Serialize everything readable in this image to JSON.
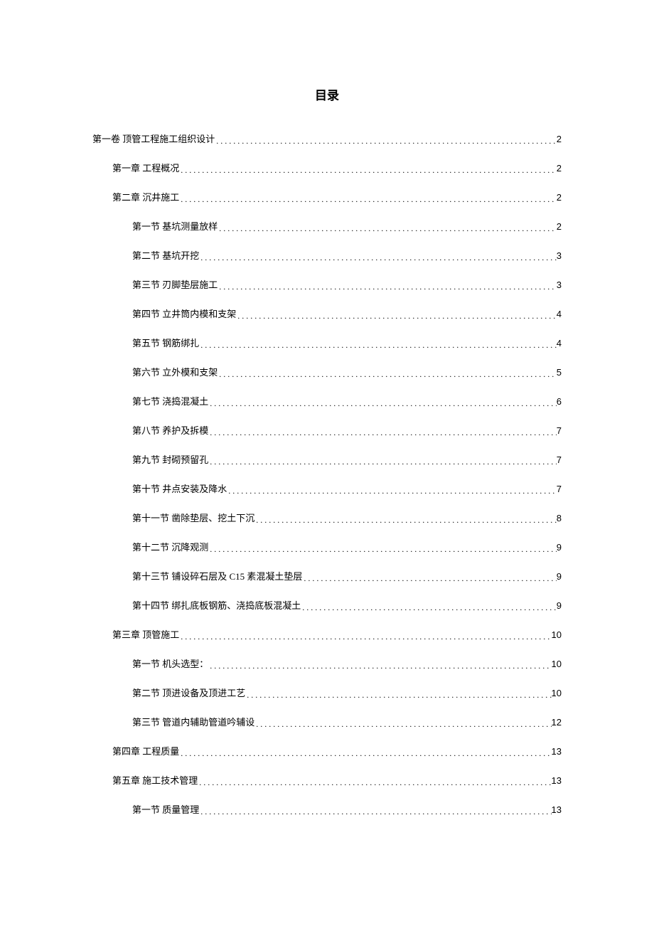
{
  "title": "目录",
  "entries": [
    {
      "indent": 0,
      "label": "第一卷 顶管工程施工组织设计",
      "page": "2"
    },
    {
      "indent": 1,
      "label": "第一章 工程概况",
      "page": "2"
    },
    {
      "indent": 1,
      "label": "第二章 沉井施工",
      "page": "2"
    },
    {
      "indent": 2,
      "label": "第一节 基坑测量放样",
      "page": "2"
    },
    {
      "indent": 2,
      "label": "第二节 基坑开挖",
      "page": "3"
    },
    {
      "indent": 2,
      "label": "第三节 刃脚垫层施工",
      "page": "3"
    },
    {
      "indent": 2,
      "label": "第四节 立井筒内模和支架",
      "page": "4"
    },
    {
      "indent": 2,
      "label": "第五节 钢筋绑扎",
      "page": "4"
    },
    {
      "indent": 2,
      "label": "第六节 立外模和支架",
      "page": "5"
    },
    {
      "indent": 2,
      "label": "第七节 浇捣混凝土",
      "page": "6"
    },
    {
      "indent": 2,
      "label": "第八节 养护及拆模",
      "page": "7"
    },
    {
      "indent": 2,
      "label": "第九节 封砌预留孔",
      "page": "7"
    },
    {
      "indent": 2,
      "label": "第十节 井点安装及降水",
      "page": "7"
    },
    {
      "indent": 2,
      "label": "第十一节 凿除垫层、挖土下沉",
      "page": "8"
    },
    {
      "indent": 2,
      "label": "第十二节 沉降观测",
      "page": "9"
    },
    {
      "indent": 2,
      "label": "第十三节 铺设碎石层及 C15 素混凝土垫层",
      "page": "9"
    },
    {
      "indent": 2,
      "label": "第十四节 绑扎底板钢筋、浇捣底板混凝土",
      "page": "9"
    },
    {
      "indent": 1,
      "label": "第三章 顶管施工",
      "page": "10"
    },
    {
      "indent": 2,
      "label": "第一节 机头选型：",
      "page": "10"
    },
    {
      "indent": 2,
      "label": "第二节 顶进设备及顶进工艺",
      "page": "10"
    },
    {
      "indent": 2,
      "label": "第三节 管道内辅助管道吟辅设",
      "page": "12"
    },
    {
      "indent": 1,
      "label": "第四章 工程质量",
      "page": "13"
    },
    {
      "indent": 1,
      "label": "第五章 施工技术管理",
      "page": "13"
    },
    {
      "indent": 2,
      "label": "第一节 质量管理",
      "page": "13"
    }
  ]
}
